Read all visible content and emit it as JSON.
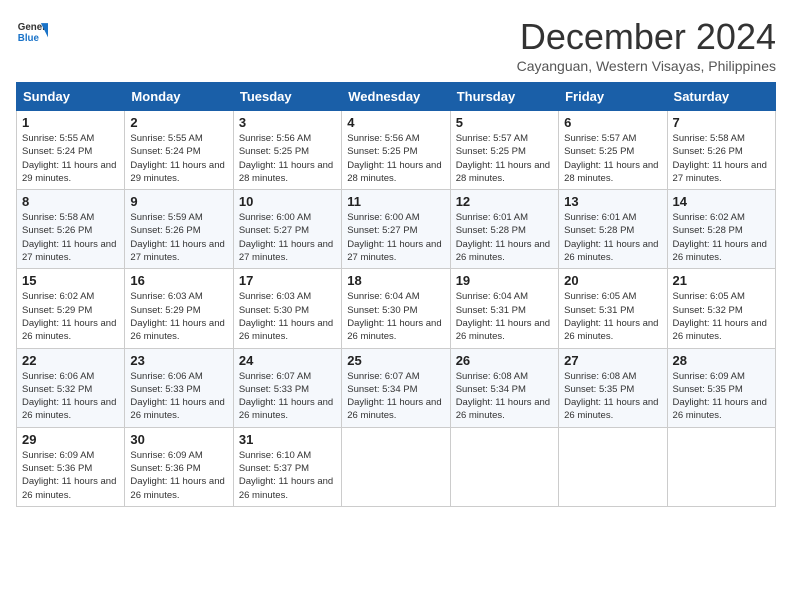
{
  "logo": {
    "line1": "General",
    "line2": "Blue"
  },
  "title": "December 2024",
  "subtitle": "Cayanguan, Western Visayas, Philippines",
  "days_of_week": [
    "Sunday",
    "Monday",
    "Tuesday",
    "Wednesday",
    "Thursday",
    "Friday",
    "Saturday"
  ],
  "weeks": [
    [
      {
        "day": "1",
        "sunrise": "5:55 AM",
        "sunset": "5:24 PM",
        "daylight": "11 hours and 29 minutes."
      },
      {
        "day": "2",
        "sunrise": "5:55 AM",
        "sunset": "5:24 PM",
        "daylight": "11 hours and 29 minutes."
      },
      {
        "day": "3",
        "sunrise": "5:56 AM",
        "sunset": "5:25 PM",
        "daylight": "11 hours and 28 minutes."
      },
      {
        "day": "4",
        "sunrise": "5:56 AM",
        "sunset": "5:25 PM",
        "daylight": "11 hours and 28 minutes."
      },
      {
        "day": "5",
        "sunrise": "5:57 AM",
        "sunset": "5:25 PM",
        "daylight": "11 hours and 28 minutes."
      },
      {
        "day": "6",
        "sunrise": "5:57 AM",
        "sunset": "5:25 PM",
        "daylight": "11 hours and 28 minutes."
      },
      {
        "day": "7",
        "sunrise": "5:58 AM",
        "sunset": "5:26 PM",
        "daylight": "11 hours and 27 minutes."
      }
    ],
    [
      {
        "day": "8",
        "sunrise": "5:58 AM",
        "sunset": "5:26 PM",
        "daylight": "11 hours and 27 minutes."
      },
      {
        "day": "9",
        "sunrise": "5:59 AM",
        "sunset": "5:26 PM",
        "daylight": "11 hours and 27 minutes."
      },
      {
        "day": "10",
        "sunrise": "6:00 AM",
        "sunset": "5:27 PM",
        "daylight": "11 hours and 27 minutes."
      },
      {
        "day": "11",
        "sunrise": "6:00 AM",
        "sunset": "5:27 PM",
        "daylight": "11 hours and 27 minutes."
      },
      {
        "day": "12",
        "sunrise": "6:01 AM",
        "sunset": "5:28 PM",
        "daylight": "11 hours and 26 minutes."
      },
      {
        "day": "13",
        "sunrise": "6:01 AM",
        "sunset": "5:28 PM",
        "daylight": "11 hours and 26 minutes."
      },
      {
        "day": "14",
        "sunrise": "6:02 AM",
        "sunset": "5:28 PM",
        "daylight": "11 hours and 26 minutes."
      }
    ],
    [
      {
        "day": "15",
        "sunrise": "6:02 AM",
        "sunset": "5:29 PM",
        "daylight": "11 hours and 26 minutes."
      },
      {
        "day": "16",
        "sunrise": "6:03 AM",
        "sunset": "5:29 PM",
        "daylight": "11 hours and 26 minutes."
      },
      {
        "day": "17",
        "sunrise": "6:03 AM",
        "sunset": "5:30 PM",
        "daylight": "11 hours and 26 minutes."
      },
      {
        "day": "18",
        "sunrise": "6:04 AM",
        "sunset": "5:30 PM",
        "daylight": "11 hours and 26 minutes."
      },
      {
        "day": "19",
        "sunrise": "6:04 AM",
        "sunset": "5:31 PM",
        "daylight": "11 hours and 26 minutes."
      },
      {
        "day": "20",
        "sunrise": "6:05 AM",
        "sunset": "5:31 PM",
        "daylight": "11 hours and 26 minutes."
      },
      {
        "day": "21",
        "sunrise": "6:05 AM",
        "sunset": "5:32 PM",
        "daylight": "11 hours and 26 minutes."
      }
    ],
    [
      {
        "day": "22",
        "sunrise": "6:06 AM",
        "sunset": "5:32 PM",
        "daylight": "11 hours and 26 minutes."
      },
      {
        "day": "23",
        "sunrise": "6:06 AM",
        "sunset": "5:33 PM",
        "daylight": "11 hours and 26 minutes."
      },
      {
        "day": "24",
        "sunrise": "6:07 AM",
        "sunset": "5:33 PM",
        "daylight": "11 hours and 26 minutes."
      },
      {
        "day": "25",
        "sunrise": "6:07 AM",
        "sunset": "5:34 PM",
        "daylight": "11 hours and 26 minutes."
      },
      {
        "day": "26",
        "sunrise": "6:08 AM",
        "sunset": "5:34 PM",
        "daylight": "11 hours and 26 minutes."
      },
      {
        "day": "27",
        "sunrise": "6:08 AM",
        "sunset": "5:35 PM",
        "daylight": "11 hours and 26 minutes."
      },
      {
        "day": "28",
        "sunrise": "6:09 AM",
        "sunset": "5:35 PM",
        "daylight": "11 hours and 26 minutes."
      }
    ],
    [
      {
        "day": "29",
        "sunrise": "6:09 AM",
        "sunset": "5:36 PM",
        "daylight": "11 hours and 26 minutes."
      },
      {
        "day": "30",
        "sunrise": "6:09 AM",
        "sunset": "5:36 PM",
        "daylight": "11 hours and 26 minutes."
      },
      {
        "day": "31",
        "sunrise": "6:10 AM",
        "sunset": "5:37 PM",
        "daylight": "11 hours and 26 minutes."
      },
      null,
      null,
      null,
      null
    ]
  ]
}
